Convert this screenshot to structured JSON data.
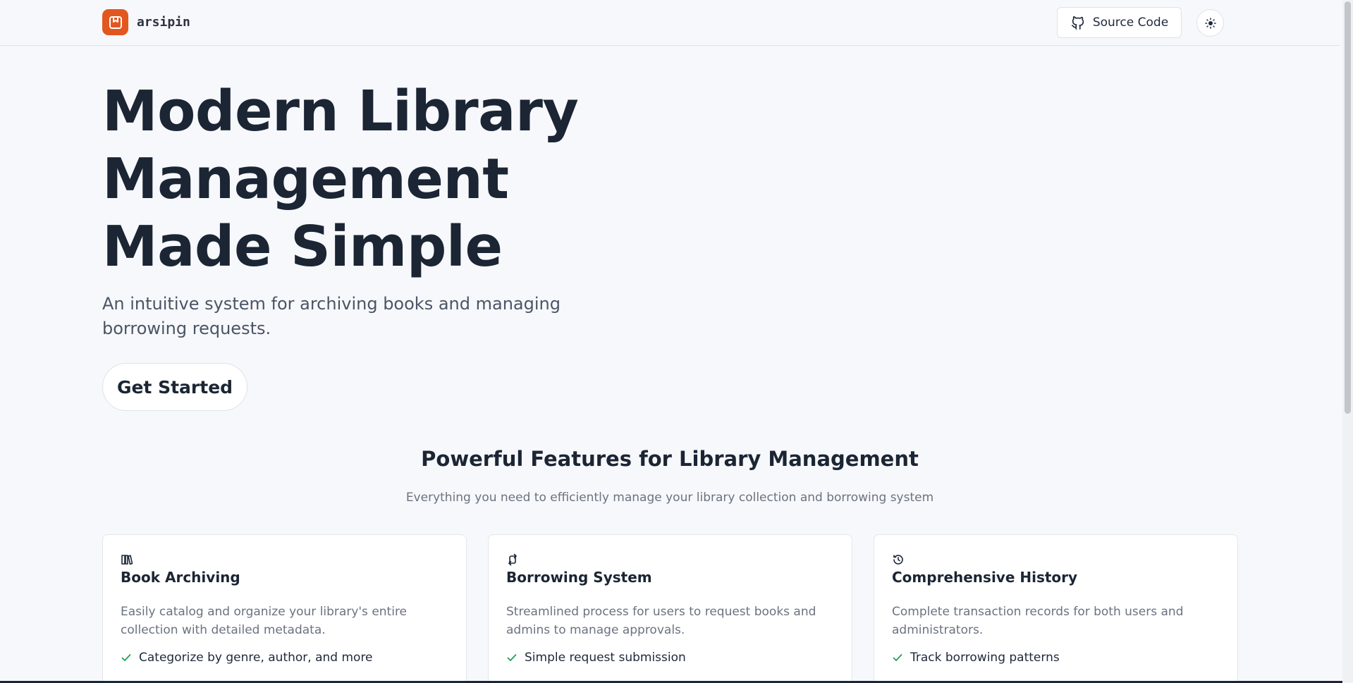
{
  "header": {
    "brand_name": "arsipin",
    "source_code_label": "Source Code",
    "theme_toggle_icon": "sun-icon"
  },
  "hero": {
    "title": "Modern Library Management Made Simple",
    "subtitle": "An intuitive system for archiving books and managing borrowing requests.",
    "cta_label": "Get Started"
  },
  "features": {
    "title": "Powerful Features for Library Management",
    "subtitle": "Everything you need to efficiently manage your library collection and borrowing system",
    "cards": [
      {
        "icon": "library-books-icon",
        "title": "Book Archiving",
        "description": "Easily catalog and organize your library's entire collection with detailed metadata.",
        "items": [
          "Categorize by genre, author, and more"
        ]
      },
      {
        "icon": "repeat-arrows-icon",
        "title": "Borrowing System",
        "description": "Streamlined process for users to request books and admins to manage approvals.",
        "items": [
          "Simple request submission"
        ]
      },
      {
        "icon": "history-icon",
        "title": "Comprehensive History",
        "description": "Complete transaction records for both users and administrators.",
        "items": [
          "Track borrowing patterns"
        ]
      }
    ]
  },
  "colors": {
    "brand": "#e2571f",
    "check": "#22a05a",
    "background": "#f7f8fb",
    "text": "#1b2534"
  }
}
